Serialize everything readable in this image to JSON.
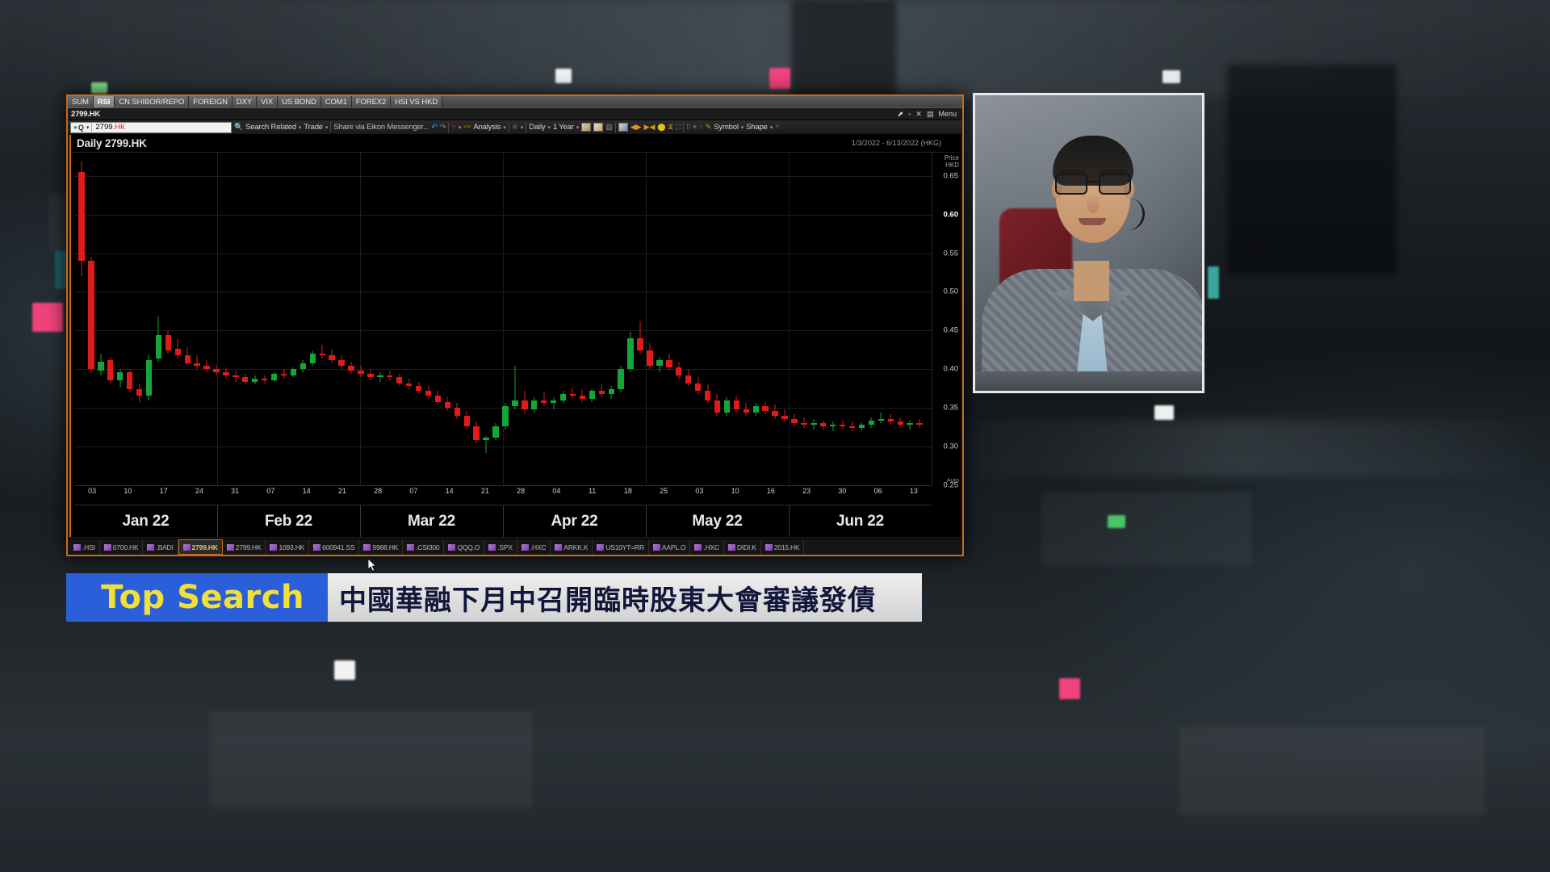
{
  "app": {
    "tabs": [
      {
        "label": "SUM",
        "active": false
      },
      {
        "label": "RSI",
        "active": true
      },
      {
        "label": "CN SHIBOR/REPO",
        "active": false
      },
      {
        "label": "FOREIGN",
        "active": false
      },
      {
        "label": "DXY",
        "active": false
      },
      {
        "label": "VIX",
        "active": false
      },
      {
        "label": "US BOND",
        "active": false
      },
      {
        "label": "COM1",
        "active": false
      },
      {
        "label": "FOREX2",
        "active": false
      },
      {
        "label": "HSI VS HKD",
        "active": false
      }
    ],
    "window_title": "2799.HK",
    "menu_label": "Menu"
  },
  "toolbar": {
    "search_value": "2799.HK",
    "search_value_prefix": "2799",
    "search_value_suffix": ".HK",
    "search_related": "Search Related",
    "trade": "Trade",
    "share": "Share via Eikon Messenger...",
    "analysis": "Analysis",
    "interval": "Daily",
    "range": "1 Year",
    "symbol": "Symbol",
    "shape": "Shape"
  },
  "chart_header": {
    "title": "Daily 2799.HK",
    "date_range": "1/3/2022 - 6/13/2022 (HKG)"
  },
  "price_axis": {
    "header_line1": "Price",
    "header_line2": "HKD",
    "auto_label": "Auto",
    "labels": [
      {
        "text": "0.65",
        "bold": false
      },
      {
        "text": "0.60",
        "bold": true
      },
      {
        "text": "0.55",
        "bold": false
      },
      {
        "text": "0.50",
        "bold": false
      },
      {
        "text": "0.45",
        "bold": false
      },
      {
        "text": "0.40",
        "bold": false
      },
      {
        "text": "0.35",
        "bold": false
      },
      {
        "text": "0.30",
        "bold": false
      },
      {
        "text": "0.25",
        "bold": false
      }
    ]
  },
  "status_bar": {
    "items": [
      {
        "label": ".HSI",
        "active": false
      },
      {
        "label": "0700.HK",
        "active": false
      },
      {
        "label": ".BADI",
        "active": false
      },
      {
        "label": "2799.HK",
        "active": true
      },
      {
        "label": "2799.HK",
        "active": false
      },
      {
        "label": "1093.HK",
        "active": false
      },
      {
        "label": "600941.SS",
        "active": false
      },
      {
        "label": "9988.HK",
        "active": false
      },
      {
        "label": ".CSI300",
        "active": false
      },
      {
        "label": "QQQ.O",
        "active": false
      },
      {
        "label": ".SPX",
        "active": false
      },
      {
        "label": ".HXC",
        "active": false
      },
      {
        "label": "ARKK.K",
        "active": false
      },
      {
        "label": "US10YT=RR",
        "active": false
      },
      {
        "label": "AAPL.O",
        "active": false
      },
      {
        "label": ".HXC",
        "active": false
      },
      {
        "label": "DIDI.K",
        "active": false
      },
      {
        "label": "2015.HK",
        "active": false
      }
    ]
  },
  "lower_third": {
    "tag": "Top Search",
    "headline": "中國華融下月中召開臨時股東大會審議發債"
  },
  "colors": {
    "window_border": "#c96a18",
    "candle_up": "#15a53a",
    "candle_down": "#e01b1b",
    "lower_third_blue": "#2b5fd9",
    "lower_third_yellow": "#f2e03a",
    "background": "#000000"
  },
  "chart_data": {
    "type": "candlestick",
    "title": "Daily 2799.HK",
    "xlabel": "",
    "ylabel": "Price HKD",
    "ylim": [
      0.25,
      0.68
    ],
    "grid": true,
    "legend": "none",
    "date_range": "1/3/2022 - 6/13/2022 (HKG)",
    "month_labels": [
      "Jan 22",
      "Feb 22",
      "Mar 22",
      "Apr 22",
      "May 22",
      "Jun 22"
    ],
    "day_ticks": [
      "03",
      "10",
      "17",
      "24",
      "31",
      "07",
      "14",
      "21",
      "28",
      "07",
      "14",
      "21",
      "28",
      "04",
      "11",
      "18",
      "25",
      "03",
      "10",
      "16",
      "23",
      "30",
      "06",
      "13"
    ],
    "price_ticks": [
      0.65,
      0.6,
      0.55,
      0.5,
      0.45,
      0.4,
      0.35,
      0.3,
      0.25
    ],
    "candles": [
      {
        "o": 0.655,
        "h": 0.668,
        "l": 0.52,
        "c": 0.54,
        "d": "down"
      },
      {
        "o": 0.54,
        "h": 0.545,
        "l": 0.395,
        "c": 0.4,
        "d": "down"
      },
      {
        "o": 0.398,
        "h": 0.42,
        "l": 0.392,
        "c": 0.41,
        "d": "up"
      },
      {
        "o": 0.412,
        "h": 0.416,
        "l": 0.382,
        "c": 0.386,
        "d": "down"
      },
      {
        "o": 0.386,
        "h": 0.4,
        "l": 0.376,
        "c": 0.396,
        "d": "up"
      },
      {
        "o": 0.396,
        "h": 0.4,
        "l": 0.37,
        "c": 0.374,
        "d": "down"
      },
      {
        "o": 0.374,
        "h": 0.382,
        "l": 0.358,
        "c": 0.366,
        "d": "down"
      },
      {
        "o": 0.366,
        "h": 0.418,
        "l": 0.36,
        "c": 0.412,
        "d": "up"
      },
      {
        "o": 0.414,
        "h": 0.468,
        "l": 0.41,
        "c": 0.444,
        "d": "up"
      },
      {
        "o": 0.444,
        "h": 0.45,
        "l": 0.42,
        "c": 0.424,
        "d": "down"
      },
      {
        "o": 0.426,
        "h": 0.44,
        "l": 0.414,
        "c": 0.418,
        "d": "down"
      },
      {
        "o": 0.418,
        "h": 0.428,
        "l": 0.404,
        "c": 0.408,
        "d": "down"
      },
      {
        "o": 0.408,
        "h": 0.418,
        "l": 0.4,
        "c": 0.404,
        "d": "down"
      },
      {
        "o": 0.404,
        "h": 0.412,
        "l": 0.396,
        "c": 0.4,
        "d": "down"
      },
      {
        "o": 0.4,
        "h": 0.406,
        "l": 0.392,
        "c": 0.396,
        "d": "down"
      },
      {
        "o": 0.396,
        "h": 0.402,
        "l": 0.388,
        "c": 0.392,
        "d": "down"
      },
      {
        "o": 0.392,
        "h": 0.398,
        "l": 0.384,
        "c": 0.39,
        "d": "down"
      },
      {
        "o": 0.39,
        "h": 0.394,
        "l": 0.38,
        "c": 0.384,
        "d": "down"
      },
      {
        "o": 0.384,
        "h": 0.392,
        "l": 0.38,
        "c": 0.388,
        "d": "up"
      },
      {
        "o": 0.388,
        "h": 0.392,
        "l": 0.382,
        "c": 0.386,
        "d": "down"
      },
      {
        "o": 0.386,
        "h": 0.396,
        "l": 0.384,
        "c": 0.394,
        "d": "up"
      },
      {
        "o": 0.394,
        "h": 0.4,
        "l": 0.388,
        "c": 0.392,
        "d": "down"
      },
      {
        "o": 0.392,
        "h": 0.402,
        "l": 0.39,
        "c": 0.4,
        "d": "up"
      },
      {
        "o": 0.4,
        "h": 0.412,
        "l": 0.396,
        "c": 0.408,
        "d": "up"
      },
      {
        "o": 0.408,
        "h": 0.424,
        "l": 0.404,
        "c": 0.42,
        "d": "up"
      },
      {
        "o": 0.42,
        "h": 0.432,
        "l": 0.414,
        "c": 0.418,
        "d": "down"
      },
      {
        "o": 0.418,
        "h": 0.426,
        "l": 0.408,
        "c": 0.412,
        "d": "down"
      },
      {
        "o": 0.412,
        "h": 0.418,
        "l": 0.4,
        "c": 0.404,
        "d": "down"
      },
      {
        "o": 0.404,
        "h": 0.41,
        "l": 0.394,
        "c": 0.398,
        "d": "down"
      },
      {
        "o": 0.398,
        "h": 0.404,
        "l": 0.39,
        "c": 0.394,
        "d": "down"
      },
      {
        "o": 0.394,
        "h": 0.4,
        "l": 0.386,
        "c": 0.39,
        "d": "down"
      },
      {
        "o": 0.39,
        "h": 0.396,
        "l": 0.384,
        "c": 0.392,
        "d": "up"
      },
      {
        "o": 0.392,
        "h": 0.398,
        "l": 0.386,
        "c": 0.39,
        "d": "down"
      },
      {
        "o": 0.39,
        "h": 0.394,
        "l": 0.378,
        "c": 0.382,
        "d": "down"
      },
      {
        "o": 0.382,
        "h": 0.388,
        "l": 0.374,
        "c": 0.378,
        "d": "down"
      },
      {
        "o": 0.378,
        "h": 0.384,
        "l": 0.368,
        "c": 0.372,
        "d": "down"
      },
      {
        "o": 0.372,
        "h": 0.378,
        "l": 0.362,
        "c": 0.366,
        "d": "down"
      },
      {
        "o": 0.366,
        "h": 0.372,
        "l": 0.354,
        "c": 0.358,
        "d": "down"
      },
      {
        "o": 0.358,
        "h": 0.364,
        "l": 0.346,
        "c": 0.35,
        "d": "down"
      },
      {
        "o": 0.35,
        "h": 0.356,
        "l": 0.336,
        "c": 0.34,
        "d": "down"
      },
      {
        "o": 0.34,
        "h": 0.346,
        "l": 0.322,
        "c": 0.326,
        "d": "down"
      },
      {
        "o": 0.326,
        "h": 0.332,
        "l": 0.304,
        "c": 0.308,
        "d": "down"
      },
      {
        "o": 0.308,
        "h": 0.314,
        "l": 0.292,
        "c": 0.312,
        "d": "up"
      },
      {
        "o": 0.312,
        "h": 0.33,
        "l": 0.308,
        "c": 0.326,
        "d": "up"
      },
      {
        "o": 0.326,
        "h": 0.356,
        "l": 0.322,
        "c": 0.352,
        "d": "up"
      },
      {
        "o": 0.352,
        "h": 0.404,
        "l": 0.348,
        "c": 0.36,
        "d": "down"
      },
      {
        "o": 0.36,
        "h": 0.372,
        "l": 0.342,
        "c": 0.348,
        "d": "down"
      },
      {
        "o": 0.348,
        "h": 0.364,
        "l": 0.344,
        "c": 0.36,
        "d": "up"
      },
      {
        "o": 0.36,
        "h": 0.37,
        "l": 0.352,
        "c": 0.356,
        "d": "down"
      },
      {
        "o": 0.356,
        "h": 0.364,
        "l": 0.348,
        "c": 0.36,
        "d": "up"
      },
      {
        "o": 0.36,
        "h": 0.372,
        "l": 0.356,
        "c": 0.368,
        "d": "up"
      },
      {
        "o": 0.368,
        "h": 0.376,
        "l": 0.362,
        "c": 0.366,
        "d": "down"
      },
      {
        "o": 0.366,
        "h": 0.374,
        "l": 0.358,
        "c": 0.362,
        "d": "down"
      },
      {
        "o": 0.362,
        "h": 0.374,
        "l": 0.358,
        "c": 0.372,
        "d": "up"
      },
      {
        "o": 0.372,
        "h": 0.38,
        "l": 0.364,
        "c": 0.368,
        "d": "down"
      },
      {
        "o": 0.368,
        "h": 0.378,
        "l": 0.362,
        "c": 0.374,
        "d": "up"
      },
      {
        "o": 0.374,
        "h": 0.404,
        "l": 0.37,
        "c": 0.4,
        "d": "up"
      },
      {
        "o": 0.4,
        "h": 0.448,
        "l": 0.396,
        "c": 0.44,
        "d": "up"
      },
      {
        "o": 0.44,
        "h": 0.462,
        "l": 0.42,
        "c": 0.424,
        "d": "down"
      },
      {
        "o": 0.424,
        "h": 0.434,
        "l": 0.4,
        "c": 0.404,
        "d": "down"
      },
      {
        "o": 0.404,
        "h": 0.416,
        "l": 0.396,
        "c": 0.412,
        "d": "up"
      },
      {
        "o": 0.412,
        "h": 0.42,
        "l": 0.398,
        "c": 0.402,
        "d": "down"
      },
      {
        "o": 0.402,
        "h": 0.41,
        "l": 0.388,
        "c": 0.392,
        "d": "down"
      },
      {
        "o": 0.392,
        "h": 0.4,
        "l": 0.378,
        "c": 0.382,
        "d": "down"
      },
      {
        "o": 0.382,
        "h": 0.39,
        "l": 0.368,
        "c": 0.372,
        "d": "down"
      },
      {
        "o": 0.372,
        "h": 0.38,
        "l": 0.356,
        "c": 0.36,
        "d": "down"
      },
      {
        "o": 0.36,
        "h": 0.368,
        "l": 0.34,
        "c": 0.344,
        "d": "down"
      },
      {
        "o": 0.344,
        "h": 0.364,
        "l": 0.34,
        "c": 0.36,
        "d": "up"
      },
      {
        "o": 0.36,
        "h": 0.366,
        "l": 0.344,
        "c": 0.348,
        "d": "down"
      },
      {
        "o": 0.348,
        "h": 0.356,
        "l": 0.34,
        "c": 0.344,
        "d": "down"
      },
      {
        "o": 0.344,
        "h": 0.356,
        "l": 0.34,
        "c": 0.352,
        "d": "up"
      },
      {
        "o": 0.352,
        "h": 0.358,
        "l": 0.342,
        "c": 0.346,
        "d": "down"
      },
      {
        "o": 0.346,
        "h": 0.354,
        "l": 0.336,
        "c": 0.34,
        "d": "down"
      },
      {
        "o": 0.34,
        "h": 0.348,
        "l": 0.332,
        "c": 0.336,
        "d": "down"
      },
      {
        "o": 0.336,
        "h": 0.342,
        "l": 0.326,
        "c": 0.33,
        "d": "down"
      },
      {
        "o": 0.33,
        "h": 0.338,
        "l": 0.324,
        "c": 0.328,
        "d": "down"
      },
      {
        "o": 0.328,
        "h": 0.336,
        "l": 0.322,
        "c": 0.33,
        "d": "up"
      },
      {
        "o": 0.33,
        "h": 0.334,
        "l": 0.322,
        "c": 0.326,
        "d": "down"
      },
      {
        "o": 0.326,
        "h": 0.332,
        "l": 0.32,
        "c": 0.328,
        "d": "up"
      },
      {
        "o": 0.328,
        "h": 0.334,
        "l": 0.322,
        "c": 0.326,
        "d": "down"
      },
      {
        "o": 0.326,
        "h": 0.332,
        "l": 0.32,
        "c": 0.324,
        "d": "down"
      },
      {
        "o": 0.324,
        "h": 0.33,
        "l": 0.32,
        "c": 0.328,
        "d": "up"
      },
      {
        "o": 0.328,
        "h": 0.338,
        "l": 0.324,
        "c": 0.334,
        "d": "up"
      },
      {
        "o": 0.334,
        "h": 0.344,
        "l": 0.33,
        "c": 0.336,
        "d": "down"
      },
      {
        "o": 0.336,
        "h": 0.342,
        "l": 0.328,
        "c": 0.332,
        "d": "down"
      },
      {
        "o": 0.332,
        "h": 0.338,
        "l": 0.324,
        "c": 0.328,
        "d": "down"
      },
      {
        "o": 0.328,
        "h": 0.334,
        "l": 0.322,
        "c": 0.33,
        "d": "up"
      },
      {
        "o": 0.33,
        "h": 0.336,
        "l": 0.324,
        "c": 0.328,
        "d": "down"
      }
    ]
  }
}
